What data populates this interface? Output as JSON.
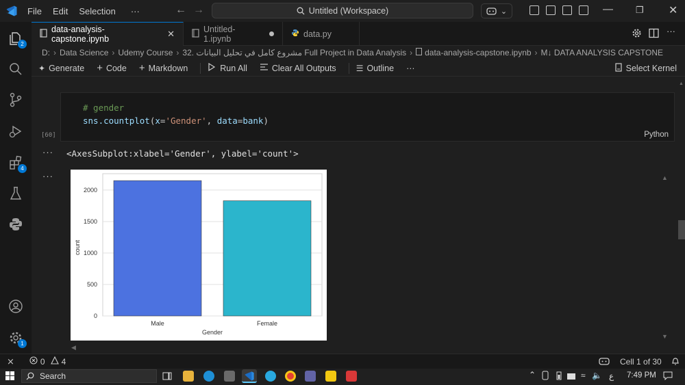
{
  "titlebar": {
    "menu": [
      "File",
      "Edit",
      "Selection",
      "···"
    ],
    "command_center": "Untitled (Workspace)"
  },
  "activity": {
    "explorer_badge": "2",
    "extensions_badge": "4",
    "settings_badge": "1"
  },
  "tabs": [
    {
      "label": "data-analysis-capstone.ipynb",
      "active": true
    },
    {
      "label": "Untitled-1.ipynb",
      "active": false
    },
    {
      "label": "data.py",
      "active": false
    }
  ],
  "breadcrumb": [
    "D:",
    "Data Science",
    "Udemy Course",
    "32. مشروع كامل في تحليل البيانات Full Project in Data Analysis",
    "data-analysis-capstone.ipynb",
    "M↓ DATA ANALYSIS CAPSTONE"
  ],
  "toolbar": {
    "generate": "Generate",
    "code": "Code",
    "markdown": "Markdown",
    "run_all": "Run All",
    "clear_outputs": "Clear All Outputs",
    "outline": "Outline",
    "more": "···",
    "select_kernel": "Select Kernel"
  },
  "cell": {
    "line1": "# gender",
    "line2_fn": "sns.countplot",
    "line2_open": "(",
    "line2_arg1": "x",
    "line2_eq1": "=",
    "line2_str": "'Gender'",
    "line2_comma": ", ",
    "line2_arg2": "data",
    "line2_eq2": "=",
    "line2_val": "bank",
    "line2_close": ")",
    "exec_count": "[60]",
    "language": "Python",
    "output_text": "<AxesSubplot:xlabel='Gender', ylabel='count'>"
  },
  "chart_data": {
    "type": "bar",
    "categories": [
      "Male",
      "Female"
    ],
    "values": [
      2150,
      1830
    ],
    "colors": [
      "#4c72e0",
      "#2bb5cc"
    ],
    "xlabel": "Gender",
    "ylabel": "count",
    "yticks": [
      0,
      500,
      1000,
      1500,
      2000
    ],
    "ylim": [
      0,
      2260
    ],
    "grid": true
  },
  "statusbar": {
    "errors": "0",
    "warnings": "4",
    "cell_pos": "Cell 1 of 30"
  },
  "taskbar": {
    "search": "Search",
    "time": "7:49 PM",
    "lang": "ع"
  }
}
